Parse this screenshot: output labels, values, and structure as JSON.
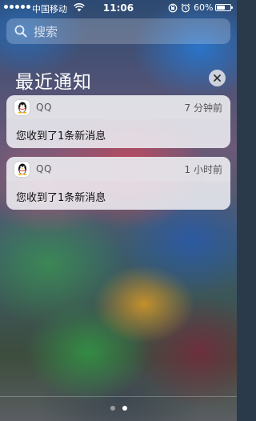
{
  "status_bar": {
    "carrier": "中国移动",
    "time": "11:06",
    "battery_percent": "60%",
    "battery_level": 0.6
  },
  "search": {
    "placeholder": "搜索"
  },
  "section": {
    "title": "最近通知"
  },
  "notifications": [
    {
      "app": "QQ",
      "time": "7 分钟前",
      "message": "您收到了1条新消息"
    },
    {
      "app": "QQ",
      "time": "1 小时前",
      "message": "您收到了1条新消息"
    }
  ],
  "icons": {
    "search": "search-icon",
    "clear": "close-icon",
    "app": "qq-penguin-icon",
    "wifi": "wifi-icon",
    "rotation_lock": "rotation-lock-icon",
    "alarm": "alarm-icon",
    "battery": "battery-icon"
  },
  "page_indicator": {
    "count": 2,
    "active": 2
  }
}
